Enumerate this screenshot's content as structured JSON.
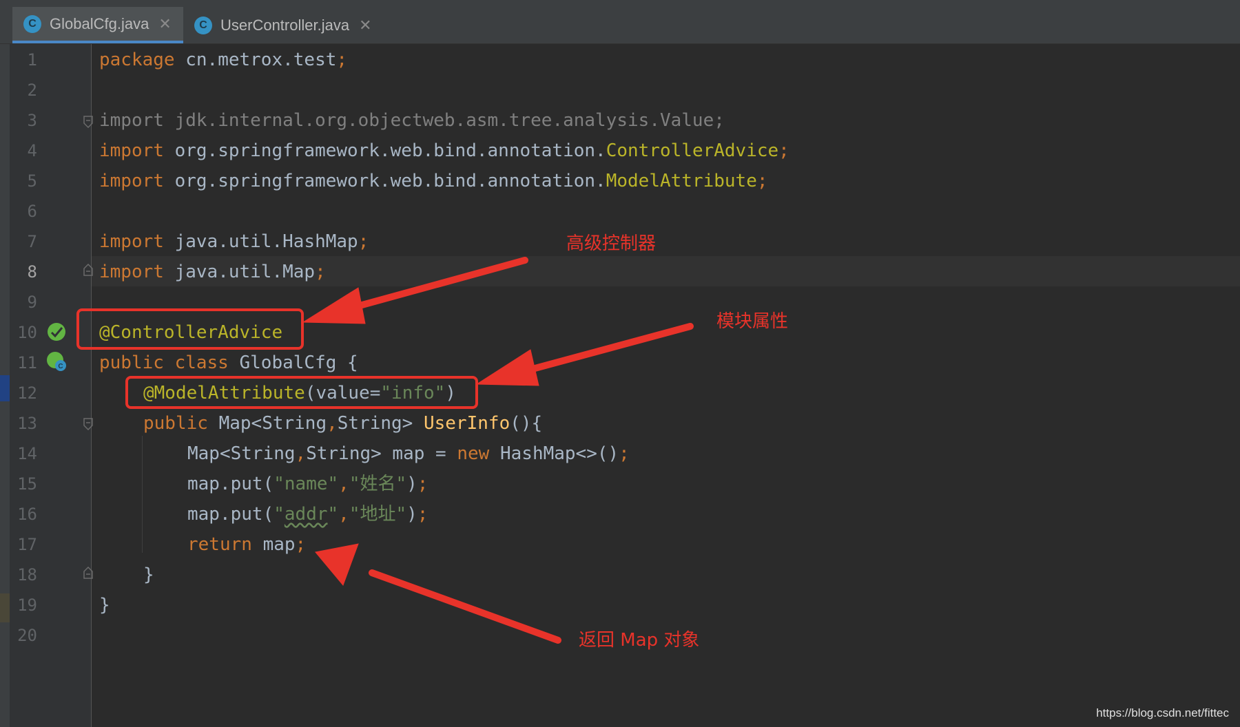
{
  "tabs": [
    {
      "label": "GlobalCfg.java",
      "icon": "class-c-icon",
      "close": "✕",
      "active": true
    },
    {
      "label": "UserController.java",
      "icon": "class-c-icon",
      "close": "✕",
      "active": false
    }
  ],
  "editor": {
    "current_line": 8,
    "line_numbers": [
      "1",
      "2",
      "3",
      "4",
      "5",
      "6",
      "7",
      "8",
      "9",
      "10",
      "11",
      "12",
      "13",
      "14",
      "15",
      "16",
      "17",
      "18",
      "19",
      "20"
    ],
    "lines": {
      "l1": [
        "package",
        " cn.metrox.test",
        ";"
      ],
      "l3": [
        "import",
        " jdk.internal.org.objectweb.asm.tree.analysis.Value;"
      ],
      "l4": [
        "import",
        " org.springframework.web.bind.annotation.",
        "ControllerAdvice",
        ";"
      ],
      "l5": [
        "import",
        " org.springframework.web.bind.annotation.",
        "ModelAttribute",
        ";"
      ],
      "l7": [
        "import",
        " java.util.HashMap",
        ";"
      ],
      "l8": [
        "import",
        " java.util.Map",
        ";"
      ],
      "l10": [
        "@ControllerAdvice"
      ],
      "l11": [
        "public class",
        " GlobalCfg {"
      ],
      "l12": [
        "@ModelAttribute",
        "(value=",
        "\"info\"",
        ")"
      ],
      "l13": [
        "public",
        " Map<String",
        ",",
        "String> ",
        "UserInfo",
        "(){"
      ],
      "l14": [
        "Map<String",
        ",",
        "String> map = ",
        "new",
        " HashMap<>()",
        ";"
      ],
      "l15": [
        "map.put(",
        "\"name\"",
        ",",
        "\"姓名\"",
        ")",
        ";"
      ],
      "l16": [
        "map.put(",
        "\"",
        "addr",
        "\"",
        ",",
        "\"地址\"",
        ")",
        ";"
      ],
      "l17": [
        "return",
        " map",
        ";"
      ],
      "l18": [
        "}"
      ],
      "l19": [
        "}"
      ]
    }
  },
  "annotations": {
    "advanced_controller": "高级控制器",
    "module_attribute": "模块属性",
    "return_map": "返回 Map 对象"
  },
  "watermark": "https://blog.csdn.net/fittec",
  "colors": {
    "keyword": "#cc7832",
    "annotation": "#bbb529",
    "string": "#6a8759",
    "method": "#ffc66d",
    "callout": "#e8332a"
  }
}
